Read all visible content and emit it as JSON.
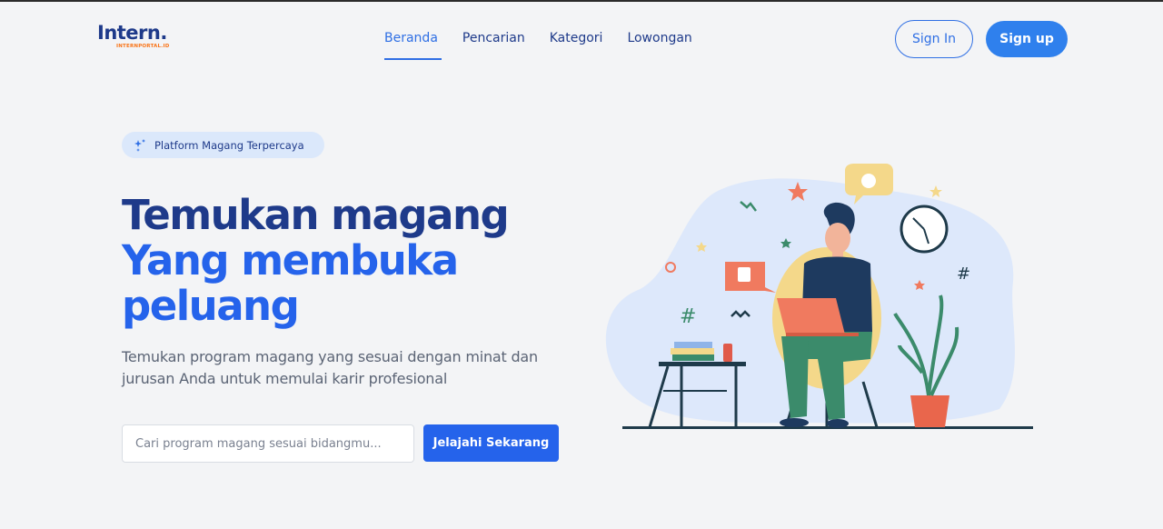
{
  "logo": {
    "wordmark": "Intern.",
    "subtext": "INTERNPORTAL.ID"
  },
  "nav": {
    "items": [
      {
        "label": "Beranda",
        "active": true
      },
      {
        "label": "Pencarian",
        "active": false
      },
      {
        "label": "Kategori",
        "active": false
      },
      {
        "label": "Lowongan",
        "active": false
      }
    ],
    "signin_label": "Sign In",
    "signup_label": "Sign up"
  },
  "hero": {
    "badge_label": "Platform Magang Terpercaya",
    "title_line1": "Temukan magang",
    "title_line2": "Yang membuka",
    "title_line3": "peluang",
    "subtitle": "Temukan program magang yang sesuai dengan minat dan jurusan Anda untuk memulai karir profesional",
    "search_placeholder": "Cari program magang sesuai bidangmu...",
    "explore_label": "Jelajahi Sekarang"
  },
  "colors": {
    "primary": "#2563eb",
    "navy": "#1e3a8a",
    "logo_accent": "#f97316",
    "background": "#f3f4f6"
  },
  "icons": [
    "sparkle-icon"
  ]
}
